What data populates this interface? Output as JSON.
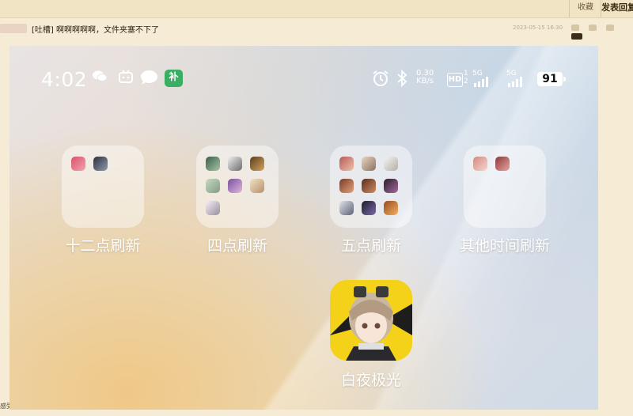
{
  "forum": {
    "collect_label": "收藏",
    "reply_label": "发表回复",
    "post_badge": "",
    "post_title": "[吐槽] 啊啊啊啊啊，文件夹塞不下了",
    "post_time": "2023-05-15 16:30",
    "bottom_text": "感受"
  },
  "status_bar": {
    "time": "4:02",
    "icons_left": [
      "wechat-icon",
      "bilibili-tv-icon",
      "chat-bubble-icon",
      "green-app-icon"
    ],
    "green_app_glyph": "补",
    "net_speed_value": "0.30",
    "net_speed_unit": "KB/s",
    "hd_label": "HD",
    "sim1": "1",
    "sim2": "2",
    "network1": "5G",
    "network2": "5G",
    "battery": "91"
  },
  "folders": [
    {
      "label": "十二点刷新",
      "app_count": 2
    },
    {
      "label": "四点刷新",
      "app_count": 7
    },
    {
      "label": "五点刷新",
      "app_count": 9
    },
    {
      "label": "其他时间刷新",
      "app_count": 2
    }
  ],
  "app": {
    "label": "白夜极光"
  },
  "colors": {
    "page_bg": "#f6ecd6",
    "folder_bg": "rgba(255,255,255,0.45)",
    "app_icon_bg": "#f5d21a",
    "green_app": "#3aae62"
  }
}
